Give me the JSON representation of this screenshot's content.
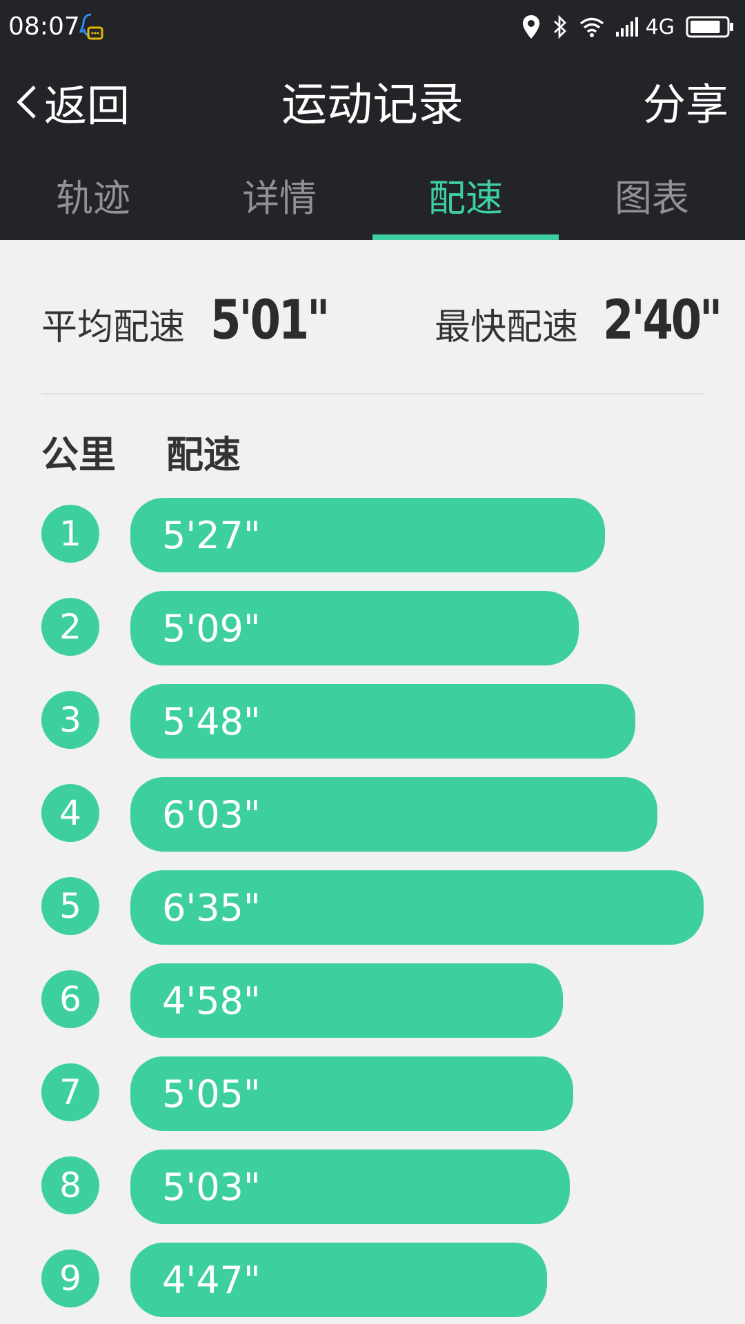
{
  "status_bar": {
    "time": "08:07",
    "network": "4G",
    "battery_level": 0.85,
    "icons": [
      "qq-notification-icon",
      "location-icon",
      "bluetooth-icon",
      "wifi-icon",
      "signal-icon",
      "battery-icon"
    ]
  },
  "header": {
    "back_label": "返回",
    "title": "运动记录",
    "share_label": "分享"
  },
  "tabs": [
    {
      "label": "轨迹",
      "active": false
    },
    {
      "label": "详情",
      "active": false
    },
    {
      "label": "配速",
      "active": true
    },
    {
      "label": "图表",
      "active": false
    }
  ],
  "summary": {
    "avg_label": "平均配速",
    "avg_value": "5'01\"",
    "fast_label": "最快配速",
    "fast_value": "2'40\""
  },
  "list_header": {
    "km_label": "公里",
    "pace_label": "配速"
  },
  "splits": [
    {
      "km": "1",
      "pace": "5'27\"",
      "seconds": 327
    },
    {
      "km": "2",
      "pace": "5'09\"",
      "seconds": 309
    },
    {
      "km": "3",
      "pace": "5'48\"",
      "seconds": 348
    },
    {
      "km": "4",
      "pace": "6'03\"",
      "seconds": 363
    },
    {
      "km": "5",
      "pace": "6'35\"",
      "seconds": 395
    },
    {
      "km": "6",
      "pace": "4'58\"",
      "seconds": 298
    },
    {
      "km": "7",
      "pace": "5'05\"",
      "seconds": 305
    },
    {
      "km": "8",
      "pace": "5'03\"",
      "seconds": 303
    },
    {
      "km": "9",
      "pace": "4'47\"",
      "seconds": 287
    }
  ],
  "colors": {
    "accent": "#3ecfa1",
    "header_bg": "#222427",
    "page_bg": "#f1f1f1"
  }
}
